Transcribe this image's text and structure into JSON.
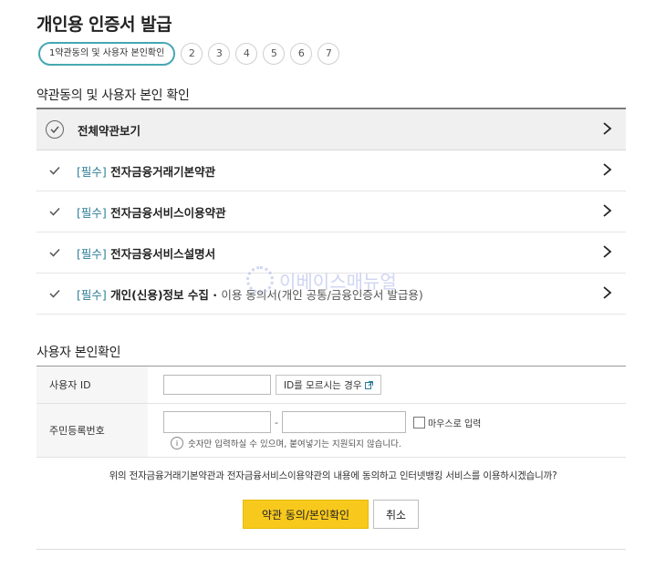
{
  "page": {
    "title": "개인용 인증서 발급"
  },
  "steps": {
    "active_label": "1약관동의 및 사용자 본인확인",
    "numbers": [
      "2",
      "3",
      "4",
      "5",
      "6",
      "7"
    ]
  },
  "terms": {
    "section_title": "약관동의 및 사용자 본인 확인",
    "all_label": "전체약관보기",
    "items": [
      {
        "req": "[필수]",
        "label": "전자금융거래기본약관",
        "sub": ""
      },
      {
        "req": "[필수]",
        "label": "전자금융서비스이용약관",
        "sub": ""
      },
      {
        "req": "[필수]",
        "label": "전자금융서비스설명서",
        "sub": ""
      },
      {
        "req": "[필수]",
        "label": "개인(신용)정보 수집 · ",
        "sub": "이용 동의서(개인 공통/금융인증서 발급용)"
      }
    ]
  },
  "watermark": {
    "text": "이베이스매뉴얼"
  },
  "identity": {
    "section_title": "사용자 본인확인",
    "user_id_label": "사용자 ID",
    "user_id_value": "",
    "find_id_button": "ID를 모르시는 경우",
    "rrn_label": "주민등록번호",
    "rrn_separator": "-",
    "mouse_input_label": "마우스로 입력",
    "notice": "숫자만 입력하실 수 있으며, 붙여넣기는 지원되지 않습니다."
  },
  "confirm": {
    "text": "위의 전자금융거래기본약관과 전자금융서비스이용약관의 내용에 동의하고 인터넷뱅킹 서비스를 이용하시겠습니까?",
    "agree_button": "약관 동의/본인확인",
    "cancel_button": "취소"
  },
  "colors": {
    "accent_teal": "#47a7b3",
    "required_blue": "#2d7d98",
    "primary_yellow": "#f8c91d"
  }
}
